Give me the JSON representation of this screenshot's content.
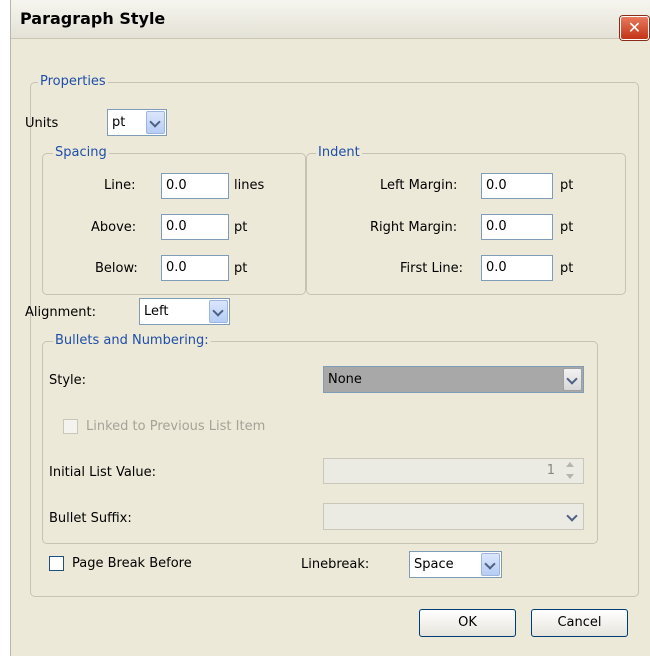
{
  "window": {
    "title": "Paragraph Style",
    "close_label": "✕"
  },
  "properties": {
    "legend": "Properties",
    "units_label": "Units",
    "units_value": "pt"
  },
  "spacing": {
    "legend": "Spacing",
    "line_label": "Line:",
    "line_value": "0.0",
    "line_unit": "lines",
    "above_label": "Above:",
    "above_value": "0.0",
    "above_unit": "pt",
    "below_label": "Below:",
    "below_value": "0.0",
    "below_unit": "pt"
  },
  "indent": {
    "legend": "Indent",
    "left_label": "Left Margin:",
    "left_value": "0.0",
    "left_unit": "pt",
    "right_label": "Right Margin:",
    "right_value": "0.0",
    "right_unit": "pt",
    "first_label": "First Line:",
    "first_value": "0.0",
    "first_unit": "pt"
  },
  "alignment": {
    "label": "Alignment:",
    "value": "Left"
  },
  "bullets": {
    "legend": "Bullets and Numbering:",
    "style_label": "Style:",
    "style_value": "None",
    "linked_label": "Linked to Previous List Item",
    "initial_label": "Initial List Value:",
    "initial_value": "1",
    "suffix_label": "Bullet Suffix:",
    "suffix_value": ""
  },
  "page_break_label": "Page Break Before",
  "linebreak": {
    "label": "Linebreak:",
    "value": "Space"
  },
  "buttons": {
    "ok": "OK",
    "cancel": "Cancel"
  }
}
